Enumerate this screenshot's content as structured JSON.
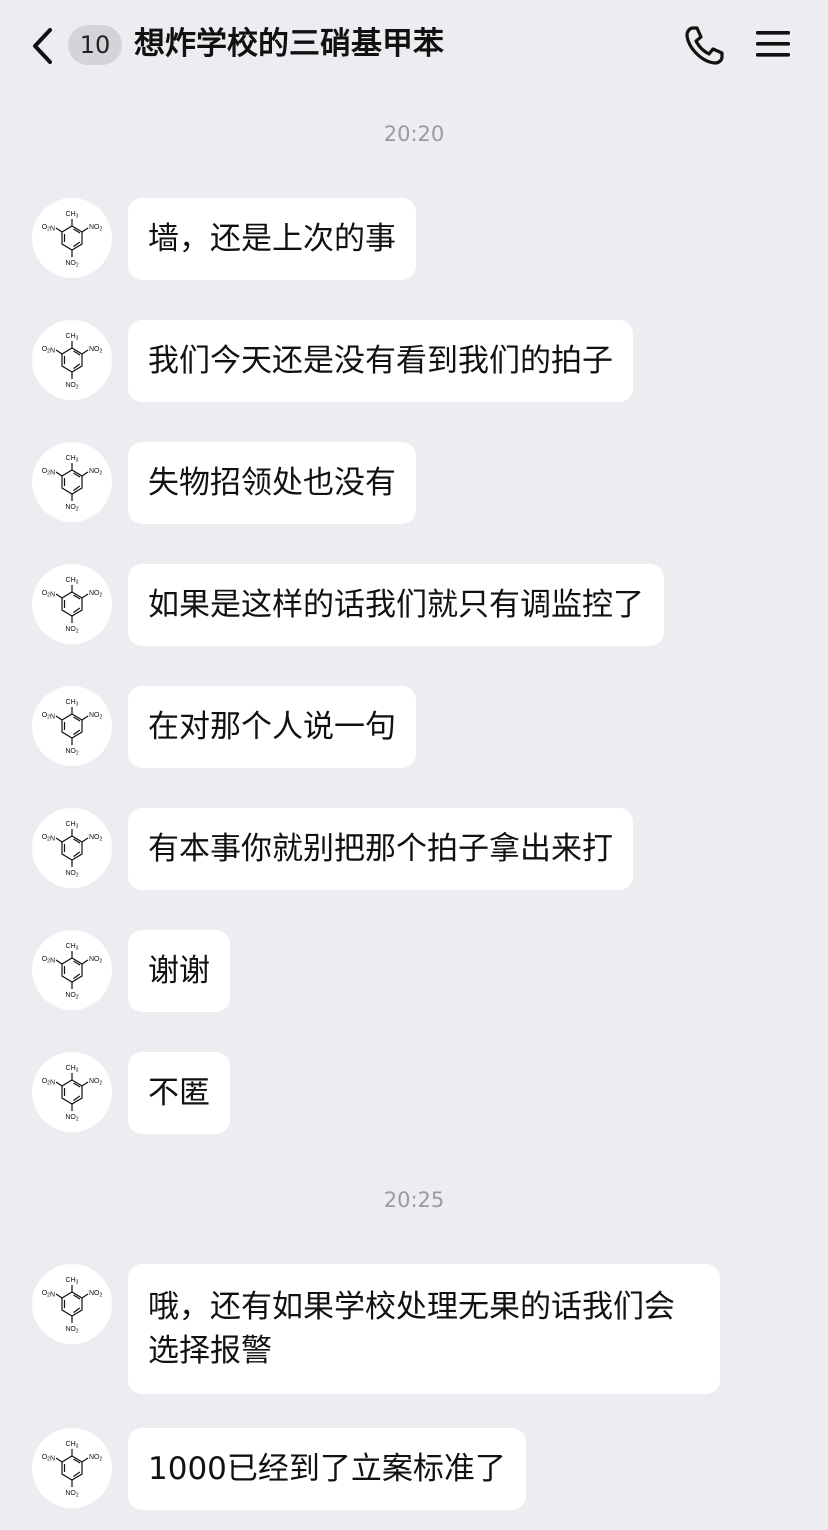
{
  "header": {
    "unread_count": "10",
    "title": "想炸学校的三硝基甲苯"
  },
  "icons": {
    "back": "chevron-left-icon",
    "phone": "phone-icon",
    "menu": "menu-icon",
    "avatar": "tnt-molecule-avatar"
  },
  "avatar_labels": {
    "top": "CH3",
    "left": "O2N",
    "right": "NO2",
    "bottom": "NO2"
  },
  "timestamps": [
    "20:20",
    "20:25"
  ],
  "messages": [
    {
      "text": "墙，还是上次的事"
    },
    {
      "text": "我们今天还是没有看到我们的拍子"
    },
    {
      "text": "失物招领处也没有"
    },
    {
      "text": "如果是这样的话我们就只有调监控了"
    },
    {
      "text": "在对那个人说一句"
    },
    {
      "text": "有本事你就别把那个拍子拿出来打"
    },
    {
      "text": "谢谢"
    },
    {
      "text": "不匿"
    },
    {
      "text": "哦，还有如果学校处理无果的话我们会选择报警"
    },
    {
      "text": "1000已经到了立案标准了"
    }
  ],
  "colors": {
    "background": "#ededf1",
    "bubble": "#ffffff",
    "badge": "#d4d4d8",
    "timestamp": "#9a9aa0"
  }
}
